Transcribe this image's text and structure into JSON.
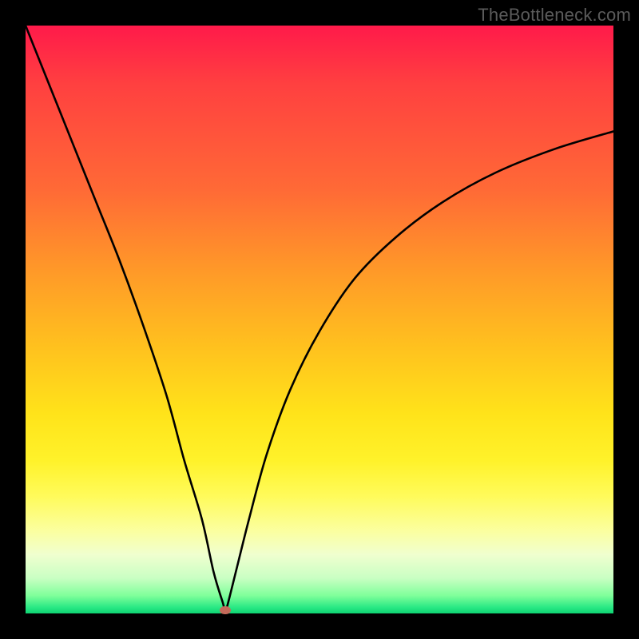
{
  "watermark": "TheBottleneck.com",
  "chart_data": {
    "type": "line",
    "title": "",
    "xlabel": "",
    "ylabel": "",
    "xlim": [
      0,
      100
    ],
    "ylim": [
      0,
      100
    ],
    "min_marker": {
      "x": 34,
      "y": 0.5
    },
    "series": [
      {
        "name": "bottleneck-curve",
        "x": [
          0,
          4,
          8,
          12,
          16,
          20,
          24,
          27,
          30,
          32,
          33.5,
          34,
          34.5,
          36,
          38,
          41,
          45,
          50,
          56,
          63,
          71,
          80,
          90,
          100
        ],
        "values": [
          100,
          90,
          80,
          70,
          60,
          49,
          37,
          26,
          16,
          7,
          2,
          0.5,
          2,
          8,
          16,
          27,
          38,
          48,
          57,
          64,
          70,
          75,
          79,
          82
        ]
      }
    ],
    "background_gradient": {
      "top": "#ff1a4a",
      "upper_mid": "#ff9a28",
      "mid": "#ffe31a",
      "lower_mid": "#fbffa0",
      "bottom": "#0ed372"
    }
  }
}
